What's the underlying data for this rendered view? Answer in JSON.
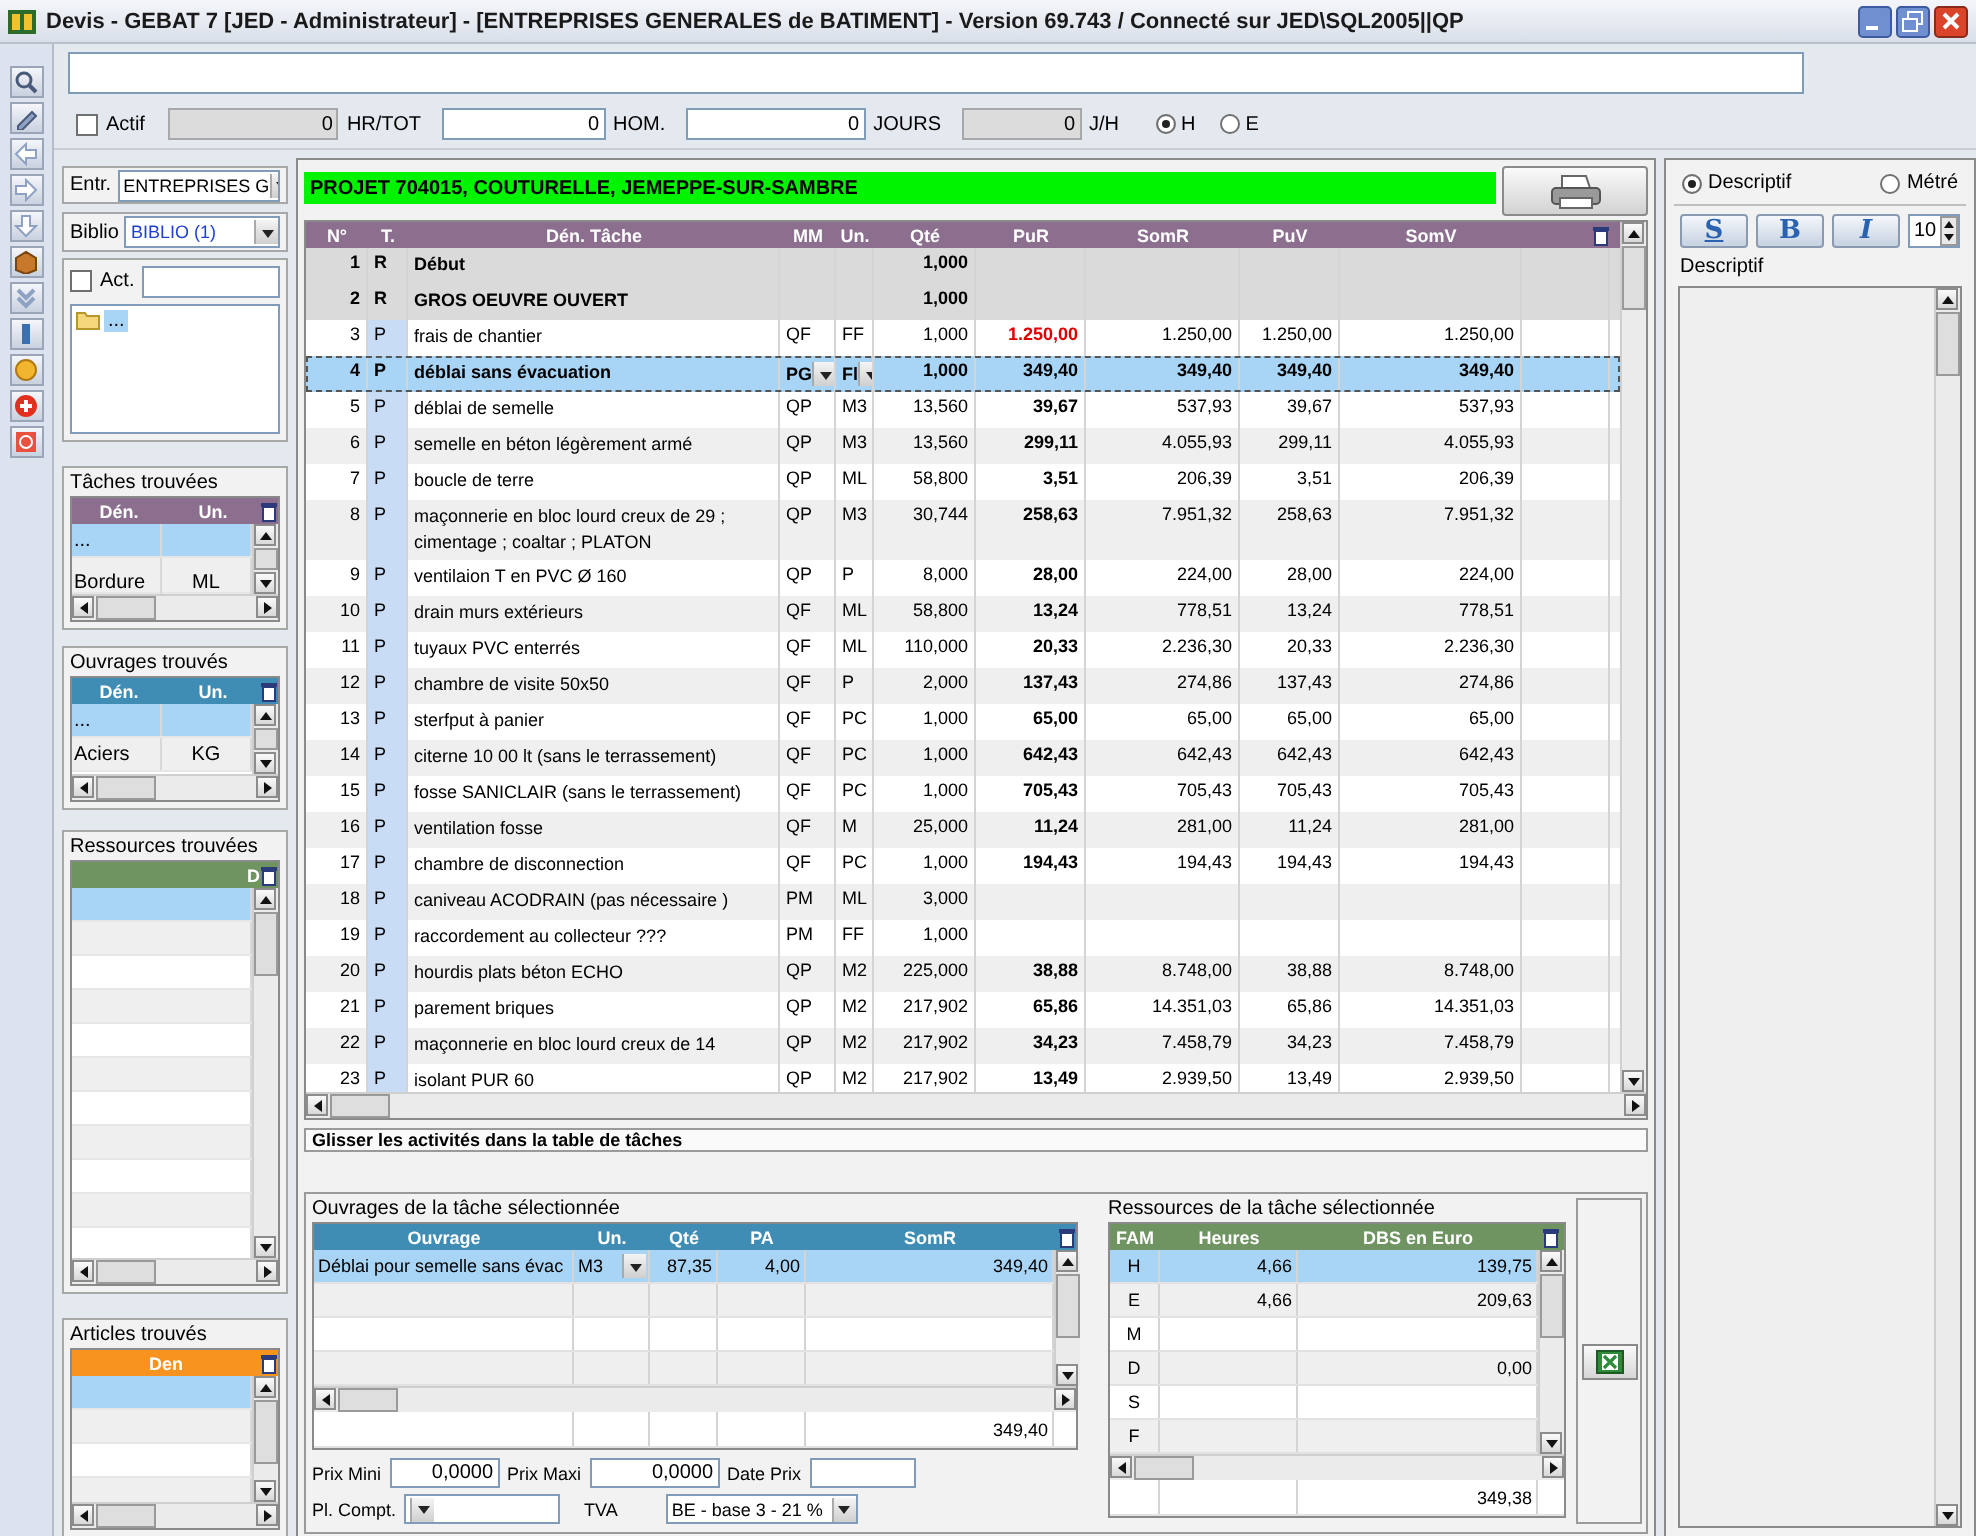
{
  "window": {
    "title": "Devis - GEBAT 7 [JED - Administrateur] - [ENTREPRISES GENERALES de BATIMENT]  - Version 69.743 / Connecté sur JED\\SQL2005||QP"
  },
  "filter_bar": {
    "fields": [
      {
        "kind": "checkbox",
        "label": "Actif",
        "checked": false
      },
      {
        "kind": "number",
        "value": "0",
        "label": "HR/TOT",
        "disabled": true
      },
      {
        "kind": "number",
        "value": "0",
        "label": "HOM.",
        "disabled": false
      },
      {
        "kind": "number",
        "value": "0",
        "label": "JOURS",
        "disabled": false
      },
      {
        "kind": "number",
        "value": "0",
        "label": "J/H",
        "disabled": true
      }
    ],
    "radios": [
      {
        "label": "H",
        "selected": true
      },
      {
        "label": "E",
        "selected": false
      }
    ]
  },
  "left_panel": {
    "entr": {
      "label": "Entr.",
      "value": "ENTREPRISES G"
    },
    "biblio": {
      "label": "Biblio",
      "value": "BIBLIO  (1)"
    },
    "act": {
      "label": "Act.",
      "checked": false
    },
    "tree": [
      {
        "label": "...",
        "selected": true
      }
    ],
    "grids": [
      {
        "title": "Tâches trouvées",
        "color": "#8c6f8f",
        "columns": [
          "Dén.",
          "Un."
        ],
        "rows": [
          {
            "cells": [
              "..."
            ],
            "selected": true
          },
          {
            "cells": [
              "Bordure",
              "ML"
            ],
            "selected": false
          }
        ]
      },
      {
        "title": "Ouvrages trouvés",
        "color": "#3f8db5",
        "columns": [
          "Dén.",
          "Un."
        ],
        "rows": [
          {
            "cells": [
              "..."
            ],
            "selected": true
          },
          {
            "cells": [
              "Aciers",
              "KG"
            ],
            "selected": false
          }
        ]
      },
      {
        "title": "Ressources trouvées",
        "color": "#6f9462",
        "columns": [
          "D"
        ],
        "rows": [
          {
            "selected": true
          }
        ]
      },
      {
        "title": "Articles trouvés",
        "color": "#f7931e",
        "columns": [
          "Den"
        ],
        "rows": [
          {
            "selected": true
          }
        ]
      }
    ]
  },
  "task_panel": {
    "project": "PROJET 704015, COUTURELLE, JEMEPPE-SUR-SAMBRE",
    "columns": [
      "N°",
      "T.",
      "Dén. Tâche",
      "MM",
      "Un.",
      "Qté",
      "PuR",
      "SomR",
      "PuV",
      "SomV"
    ],
    "rows": [
      {
        "kind": "section",
        "selected": false,
        "no": "1",
        "t": "R",
        "name": "Début",
        "qte": "1,000"
      },
      {
        "kind": "section",
        "selected": false,
        "no": "2",
        "t": "R",
        "name": "GROS OEUVRE OUVERT",
        "qte": "1,000"
      },
      {
        "kind": "task",
        "selected": false,
        "alert": true,
        "no": "3",
        "t": "P",
        "name": "frais de chantier",
        "mm": "QF",
        "un": "FF",
        "qte": "1,000",
        "pur": "1.250,00",
        "somr": "1.250,00",
        "puv": "1.250,00",
        "somv": "1.250,00"
      },
      {
        "kind": "task",
        "selected": true,
        "alert": false,
        "no": "4",
        "t": "P",
        "name": "déblai sans évacuation",
        "mm": "PG",
        "un": "Fl",
        "qte": "1,000",
        "pur": "349,40",
        "somr": "349,40",
        "puv": "349,40",
        "somv": "349,40"
      },
      {
        "kind": "task",
        "selected": false,
        "alert": false,
        "no": "5",
        "t": "P",
        "name": "déblai de semelle",
        "mm": "QP",
        "un": "M3",
        "qte": "13,560",
        "pur": "39,67",
        "somr": "537,93",
        "puv": "39,67",
        "somv": "537,93"
      },
      {
        "kind": "task",
        "selected": false,
        "alert": false,
        "no": "6",
        "t": "P",
        "name": "semelle en béton légèrement armé",
        "mm": "QP",
        "un": "M3",
        "qte": "13,560",
        "pur": "299,11",
        "somr": "4.055,93",
        "puv": "299,11",
        "somv": "4.055,93"
      },
      {
        "kind": "task",
        "selected": false,
        "alert": false,
        "no": "7",
        "t": "P",
        "name": "boucle de terre",
        "mm": "QP",
        "un": "ML",
        "qte": "58,800",
        "pur": "3,51",
        "somr": "206,39",
        "puv": "3,51",
        "somv": "206,39"
      },
      {
        "kind": "task",
        "selected": false,
        "alert": false,
        "no": "8",
        "t": "P",
        "name": "maçonnerie en bloc lourd creux de 29 ; cimentage ; coaltar ; PLATON",
        "mm": "QP",
        "un": "M3",
        "qte": "30,744",
        "pur": "258,63",
        "somr": "7.951,32",
        "puv": "258,63",
        "somv": "7.951,32"
      },
      {
        "kind": "task",
        "selected": false,
        "alert": false,
        "no": "9",
        "t": "P",
        "name": "ventilaion T en PVC Ø 160",
        "mm": "QP",
        "un": "P",
        "qte": "8,000",
        "pur": "28,00",
        "somr": "224,00",
        "puv": "28,00",
        "somv": "224,00"
      },
      {
        "kind": "task",
        "selected": false,
        "alert": false,
        "no": "10",
        "t": "P",
        "name": "drain murs extérieurs",
        "mm": "QF",
        "un": "ML",
        "qte": "58,800",
        "pur": "13,24",
        "somr": "778,51",
        "puv": "13,24",
        "somv": "778,51"
      },
      {
        "kind": "task",
        "selected": false,
        "alert": false,
        "no": "11",
        "t": "P",
        "name": "tuyaux PVC enterrés",
        "mm": "QF",
        "un": "ML",
        "qte": "110,000",
        "pur": "20,33",
        "somr": "2.236,30",
        "puv": "20,33",
        "somv": "2.236,30"
      },
      {
        "kind": "task",
        "selected": false,
        "alert": false,
        "no": "12",
        "t": "P",
        "name": "chambre de visite 50x50",
        "mm": "QF",
        "un": "P",
        "qte": "2,000",
        "pur": "137,43",
        "somr": "274,86",
        "puv": "137,43",
        "somv": "274,86"
      },
      {
        "kind": "task",
        "selected": false,
        "alert": false,
        "no": "13",
        "t": "P",
        "name": "sterfput à panier",
        "mm": "QF",
        "un": "PC",
        "qte": "1,000",
        "pur": "65,00",
        "somr": "65,00",
        "puv": "65,00",
        "somv": "65,00"
      },
      {
        "kind": "task",
        "selected": false,
        "alert": false,
        "no": "14",
        "t": "P",
        "name": "citerne 10 00 lt (sans le terrassement)",
        "mm": "QF",
        "un": "PC",
        "qte": "1,000",
        "pur": "642,43",
        "somr": "642,43",
        "puv": "642,43",
        "somv": "642,43"
      },
      {
        "kind": "task",
        "selected": false,
        "alert": false,
        "no": "15",
        "t": "P",
        "name": "fosse SANICLAIR (sans le terrassement)",
        "mm": "QF",
        "un": "PC",
        "qte": "1,000",
        "pur": "705,43",
        "somr": "705,43",
        "puv": "705,43",
        "somv": "705,43"
      },
      {
        "kind": "task",
        "selected": false,
        "alert": false,
        "no": "16",
        "t": "P",
        "name": "ventilation fosse",
        "mm": "QF",
        "un": "M",
        "qte": "25,000",
        "pur": "11,24",
        "somr": "281,00",
        "puv": "11,24",
        "somv": "281,00"
      },
      {
        "kind": "task",
        "selected": false,
        "alert": false,
        "no": "17",
        "t": "P",
        "name": "chambre de disconnection",
        "mm": "QF",
        "un": "PC",
        "qte": "1,000",
        "pur": "194,43",
        "somr": "194,43",
        "puv": "194,43",
        "somv": "194,43"
      },
      {
        "kind": "task",
        "selected": false,
        "no": "18",
        "t": "P",
        "name": "caniveau ACODRAIN  (pas nécessaire )",
        "mm": "PM",
        "un": "ML",
        "qte": "3,000"
      },
      {
        "kind": "task",
        "selected": false,
        "no": "19",
        "t": "P",
        "name": "raccordement au collecteur  ???",
        "mm": "PM",
        "un": "FF",
        "qte": "1,000"
      },
      {
        "kind": "task",
        "selected": false,
        "alert": false,
        "no": "20",
        "t": "P",
        "name": "hourdis plats béton ECHO",
        "mm": "QP",
        "un": "M2",
        "qte": "225,000",
        "pur": "38,88",
        "somr": "8.748,00",
        "puv": "38,88",
        "somv": "8.748,00"
      },
      {
        "kind": "task",
        "selected": false,
        "alert": false,
        "no": "21",
        "t": "P",
        "name": "parement briques",
        "mm": "QP",
        "un": "M2",
        "qte": "217,902",
        "pur": "65,86",
        "somr": "14.351,03",
        "puv": "65,86",
        "somv": "14.351,03"
      },
      {
        "kind": "task",
        "selected": false,
        "alert": false,
        "no": "22",
        "t": "P",
        "name": "maçonnerie en bloc lourd creux de 14",
        "mm": "QP",
        "un": "M2",
        "qte": "217,902",
        "pur": "34,23",
        "somr": "7.458,79",
        "puv": "34,23",
        "somv": "7.458,79"
      },
      {
        "kind": "task",
        "selected": false,
        "alert": false,
        "no": "23",
        "t": "P",
        "name": "isolant PUR 60",
        "mm": "QP",
        "un": "M2",
        "qte": "217,902",
        "pur": "13,49",
        "somr": "2.939,50",
        "puv": "13,49",
        "somv": "2.939,50"
      }
    ],
    "hint": "Glisser les activités dans la table de tâches"
  },
  "ouvrages": {
    "title": "Ouvrages de la tâche sélectionnée",
    "columns": [
      "Ouvrage",
      "Un.",
      "Qté",
      "PA",
      "SomR"
    ],
    "rows": [
      {
        "ouvrage": "Déblai pour semelle sans évac",
        "un": "M3",
        "qte": "87,35",
        "pa": "4,00",
        "somr": "349,40",
        "selected": true
      }
    ],
    "total": "349,40"
  },
  "price_fields": {
    "prix_mini": {
      "label": "Prix Mini",
      "value": "0,0000"
    },
    "prix_maxi": {
      "label": "Prix Maxi",
      "value": "0,0000"
    },
    "date_prix": {
      "label": "Date Prix"
    },
    "pl_compt": {
      "label": "Pl. Compt."
    },
    "tva": {
      "label": "TVA",
      "value": "BE - base 3 - 21 %"
    }
  },
  "ressources": {
    "title": "Ressources de la tâche sélectionnée",
    "columns": [
      "FAM",
      "Heures",
      "DBS en Euro"
    ],
    "rows": [
      {
        "fam": "H",
        "heures": "4,66",
        "dbs": "139,75",
        "selected": true
      },
      {
        "fam": "E",
        "heures": "4,66",
        "dbs": "209,63",
        "selected": false
      },
      {
        "fam": "M",
        "selected": false
      },
      {
        "fam": "D",
        "dbs": "0,00",
        "selected": false
      },
      {
        "fam": "S",
        "selected": false
      },
      {
        "fam": "F",
        "selected": false
      }
    ],
    "total": "349,38"
  },
  "description_panel": {
    "modes": [
      {
        "label": "Descriptif",
        "selected": true
      },
      {
        "label": "Métré",
        "selected": false
      }
    ],
    "format_buttons": [
      "S",
      "B",
      "I"
    ],
    "font_size": "10",
    "label": "Descriptif"
  }
}
